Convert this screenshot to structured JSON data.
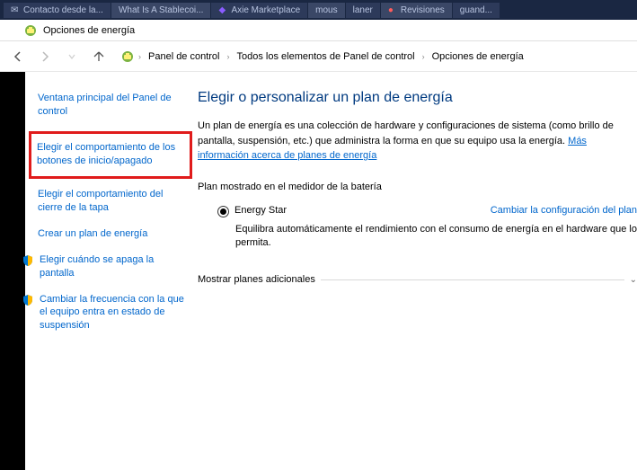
{
  "tabs": [
    {
      "label": "Contacto desde la..."
    },
    {
      "label": "What Is A Stablecoi..."
    },
    {
      "label": "Axie Marketplace"
    },
    {
      "label": "mous"
    },
    {
      "label": "laner"
    },
    {
      "label": "Revisiones"
    },
    {
      "label": "guand..."
    }
  ],
  "window": {
    "title": "Opciones de energía"
  },
  "breadcrumb": {
    "p1": "Panel de control",
    "p2": "Todos los elementos de Panel de control",
    "p3": "Opciones de energía"
  },
  "sidebar": {
    "items": [
      "Ventana principal del Panel de control",
      "Elegir el comportamiento de los botones de inicio/apagado",
      "Elegir el comportamiento del cierre de la tapa",
      "Crear un plan de energía",
      "Elegir cuándo se apaga la pantalla",
      "Cambiar la frecuencia con la que el equipo entra en estado de suspensión"
    ]
  },
  "main": {
    "heading": "Elegir o personalizar un plan de energía",
    "desc_pre": "Un plan de energía es una colección de hardware y configuraciones de sistema (como brillo de pantalla, suspensión, etc.) que administra la forma en que su equipo usa la energía. ",
    "desc_link": "Más información acerca de planes de energía",
    "section_label": "Plan mostrado en el medidor de la batería",
    "plan_name": "Energy Star",
    "plan_change": "Cambiar la configuración del plan",
    "plan_desc": "Equilibra automáticamente el rendimiento con el consumo de energía en el hardware que lo permita.",
    "expander": "Mostrar planes adicionales"
  }
}
